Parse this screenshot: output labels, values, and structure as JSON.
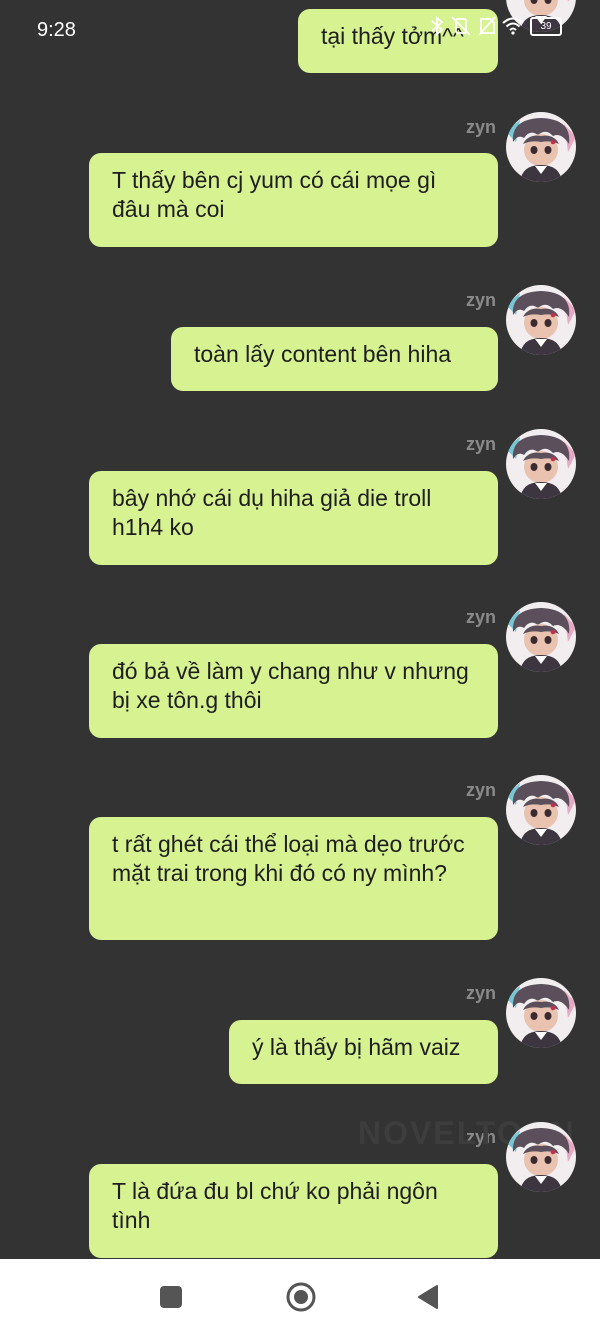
{
  "status_bar": {
    "time": "9:28",
    "battery": "39"
  },
  "messages": [
    {
      "sender": "",
      "text": "tại thấy tởm^^"
    },
    {
      "sender": "zyn",
      "text": "T thấy bên cj yum có cái mọe gì đâu mà coi"
    },
    {
      "sender": "zyn",
      "text": "toàn lấy content bên hiha"
    },
    {
      "sender": "zyn",
      "text": "bây nhớ cái dụ hiha giả die troll h1h4 ko"
    },
    {
      "sender": "zyn",
      "text": "đó bả về làm y chang như v nhưng bị xe tôn.g thôi"
    },
    {
      "sender": "zyn",
      "text": "t rất ghét cái thể loại mà dẹo trước mặt trai trong khi đó có ny mình?"
    },
    {
      "sender": "zyn",
      "text": "ý là thấy bị hãm vaiz"
    },
    {
      "sender": "zyn",
      "text": "T là đứa đu bl chứ ko phải ngôn tình"
    }
  ],
  "watermark": "NOVELTOON",
  "colors": {
    "background": "#333333",
    "bubble": "#d6f291",
    "bubble_text": "#1e1e1e",
    "sender": "#8a8a8a"
  },
  "icons": [
    "bluetooth-icon",
    "vibrate-off-icon",
    "no-sim-icon",
    "wifi-icon",
    "battery-icon",
    "recent-apps-icon",
    "home-icon",
    "back-icon"
  ]
}
